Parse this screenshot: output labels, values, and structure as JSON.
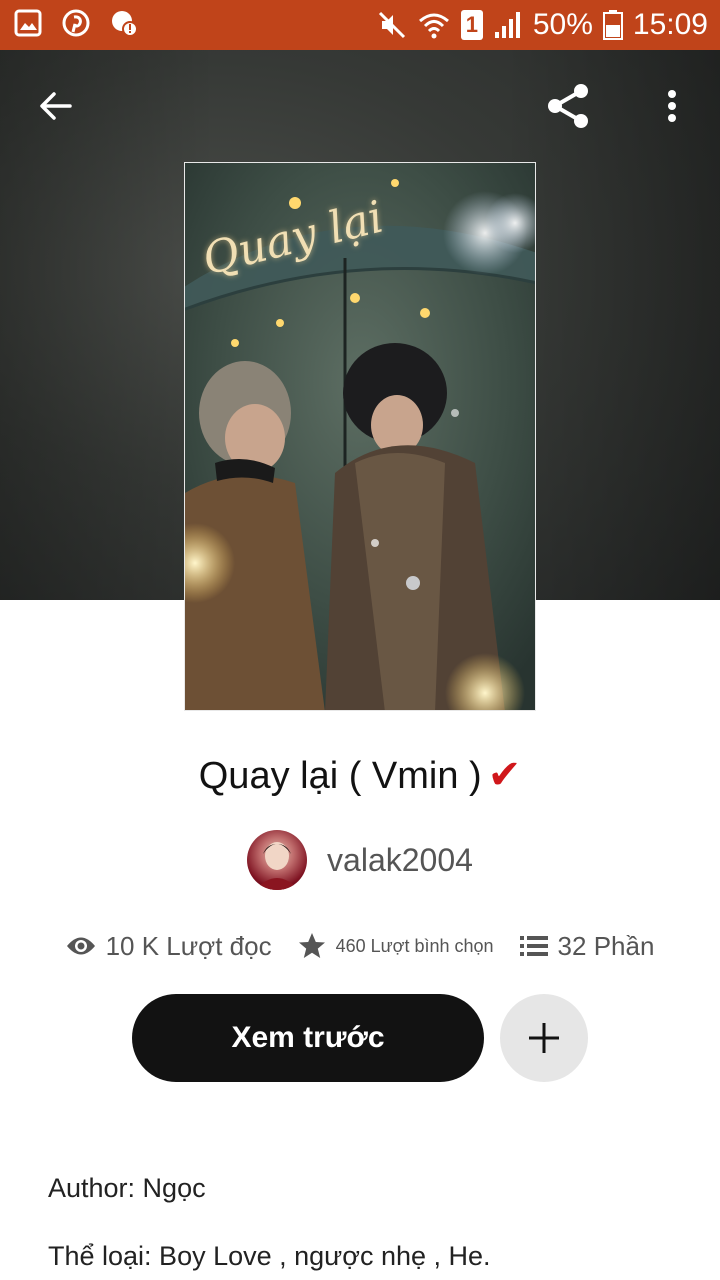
{
  "status_bar": {
    "battery": "50%",
    "time": "15:09",
    "sim": "1",
    "bg_color": "#c0441a"
  },
  "toolbar": {
    "back_icon": "back-arrow-icon",
    "share_icon": "share-icon",
    "menu_icon": "more-vert-icon"
  },
  "cover": {
    "title_text": "Quay lại"
  },
  "story": {
    "title": "Quay lại ( Vmin )",
    "verified_mark": "✔",
    "author": "valak2004"
  },
  "stats": {
    "reads": "10 K Lượt đọc",
    "votes": "460 Lượt bình chọn",
    "parts": "32 Phần"
  },
  "actions": {
    "read_label": "Xem trước",
    "add_icon": "plus-icon"
  },
  "description": {
    "lines": [
      "Author: Ngọc",
      "Thể loại: Boy Love , ngược nhẹ , He."
    ]
  }
}
